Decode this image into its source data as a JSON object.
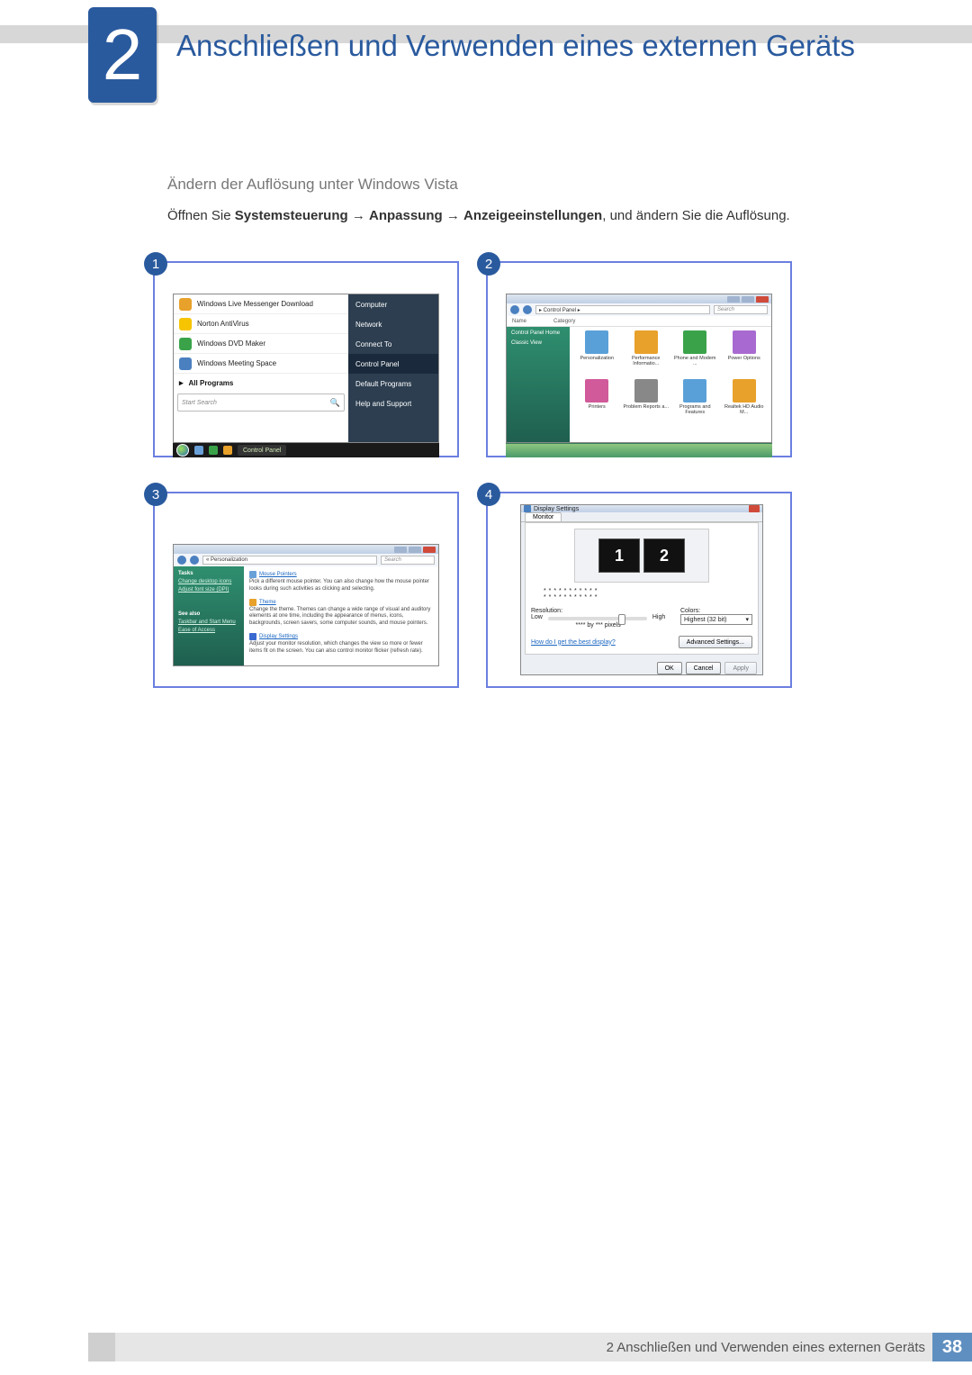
{
  "chapter_number": "2",
  "chapter_title": "Anschließen und Verwenden eines externen Geräts",
  "subheading": "Ändern der Auflösung unter Windows Vista",
  "instruction_parts": {
    "pre": "Öffnen Sie ",
    "b1": "Systemsteuerung",
    "arr1": " → ",
    "b2": "Anpassung",
    "arr2": " → ",
    "b3": "Anzeigeeinstellungen",
    "post": ", und ändern Sie die Auflösung."
  },
  "fig_labels": {
    "n1": "1",
    "n2": "2",
    "n3": "3",
    "n4": "4"
  },
  "fig1": {
    "items": {
      "i0": "Windows Live Messenger Download",
      "i1": "Norton AntiVirus",
      "i2": "Windows DVD Maker",
      "i3": "Windows Meeting Space"
    },
    "all_programs": "All Programs",
    "search_placeholder": "Start Search",
    "right": {
      "r0": "Computer",
      "r1": "Network",
      "r2": "Connect To",
      "r3": "Control Panel",
      "r4": "Default Programs",
      "r5": "Help and Support"
    },
    "taskbar_app": "Control Panel"
  },
  "fig2": {
    "breadcrumb": "▸ Control Panel ▸",
    "search": "Search",
    "col_name": "Name",
    "col_cat": "Category",
    "side": {
      "s0": "Control Panel Home",
      "s1": "Classic View"
    },
    "icons": {
      "c0": "Personalization",
      "c1": "Performance Informatio...",
      "c2": "Phone and Modem ...",
      "c3": "Power Options",
      "c4": "Printers",
      "c5": "Problem Reports a...",
      "c6": "Programs and Features",
      "c7": "Realtek HD Audio M..."
    }
  },
  "fig3": {
    "breadcrumb": "« Personalization",
    "search": "Search",
    "side": {
      "tasks": "Tasks",
      "t0": "Change desktop icons",
      "t1": "Adjust font size (DPI)",
      "see_also": "See also",
      "s0": "Taskbar and Start Menu",
      "s1": "Ease of Access"
    },
    "main": {
      "mp_title": "Mouse Pointers",
      "mp_desc": "Pick a different mouse pointer. You can also change how the mouse pointer looks during such activities as clicking and selecting.",
      "th_title": "Theme",
      "th_desc": "Change the theme. Themes can change a wide range of visual and auditory elements at one time, including the appearance of menus, icons, backgrounds, screen savers, some computer sounds, and mouse pointers.",
      "ds_title": "Display Settings",
      "ds_desc": "Adjust your monitor resolution, which changes the view so more or fewer items fit on the screen. You can also control monitor flicker (refresh rate)."
    }
  },
  "fig4": {
    "title": "Display Settings",
    "tab": "Monitor",
    "mon1": "1",
    "mon2": "2",
    "stars1": "* * * * * * * * * * *",
    "stars2": "* * * * * * * * * * *",
    "res_label": "Resolution:",
    "low": "Low",
    "high": "High",
    "res_value": "**** by *** pixels",
    "colors_label": "Colors:",
    "colors_value": "Highest (32 bit)",
    "help_link": "How do I get the best display?",
    "adv_btn": "Advanced Settings...",
    "ok": "OK",
    "cancel": "Cancel",
    "apply": "Apply"
  },
  "footer": {
    "text": "2 Anschließen und Verwenden eines externen Geräts",
    "page": "38"
  }
}
